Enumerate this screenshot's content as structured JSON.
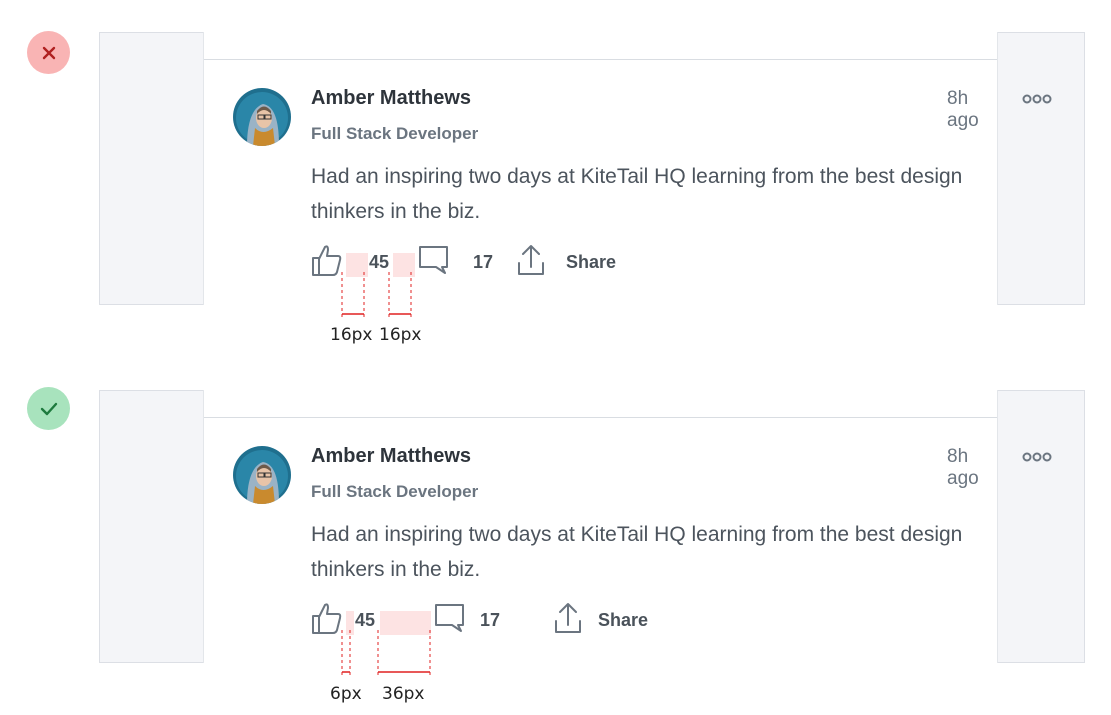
{
  "examples": [
    {
      "verdict": "incorrect",
      "badge_icon": "x-icon",
      "post": {
        "author": "Amber Matthews",
        "role": "Full Stack Developer",
        "time": "8h ago",
        "body": "Had an inspiring two days at KiteTail HQ learning from the best design thinkers in the biz.",
        "likes": "45",
        "comments": "17",
        "share_label": "Share"
      },
      "measures": [
        "16px",
        "16px"
      ]
    },
    {
      "verdict": "correct",
      "badge_icon": "check-icon",
      "post": {
        "author": "Amber Matthews",
        "role": "Full Stack Developer",
        "time": "8h ago",
        "body": "Had an inspiring two days at KiteTail HQ learning from the best design thinkers in the biz.",
        "likes": "45",
        "comments": "17",
        "share_label": "Share"
      },
      "measures": [
        "6px",
        "36px"
      ]
    }
  ],
  "colors": {
    "bad_badge": "#f9b4b4",
    "good_badge": "#a8e3bd",
    "measure_red": "#e02020",
    "gap_highlight": "#fde3e3"
  }
}
